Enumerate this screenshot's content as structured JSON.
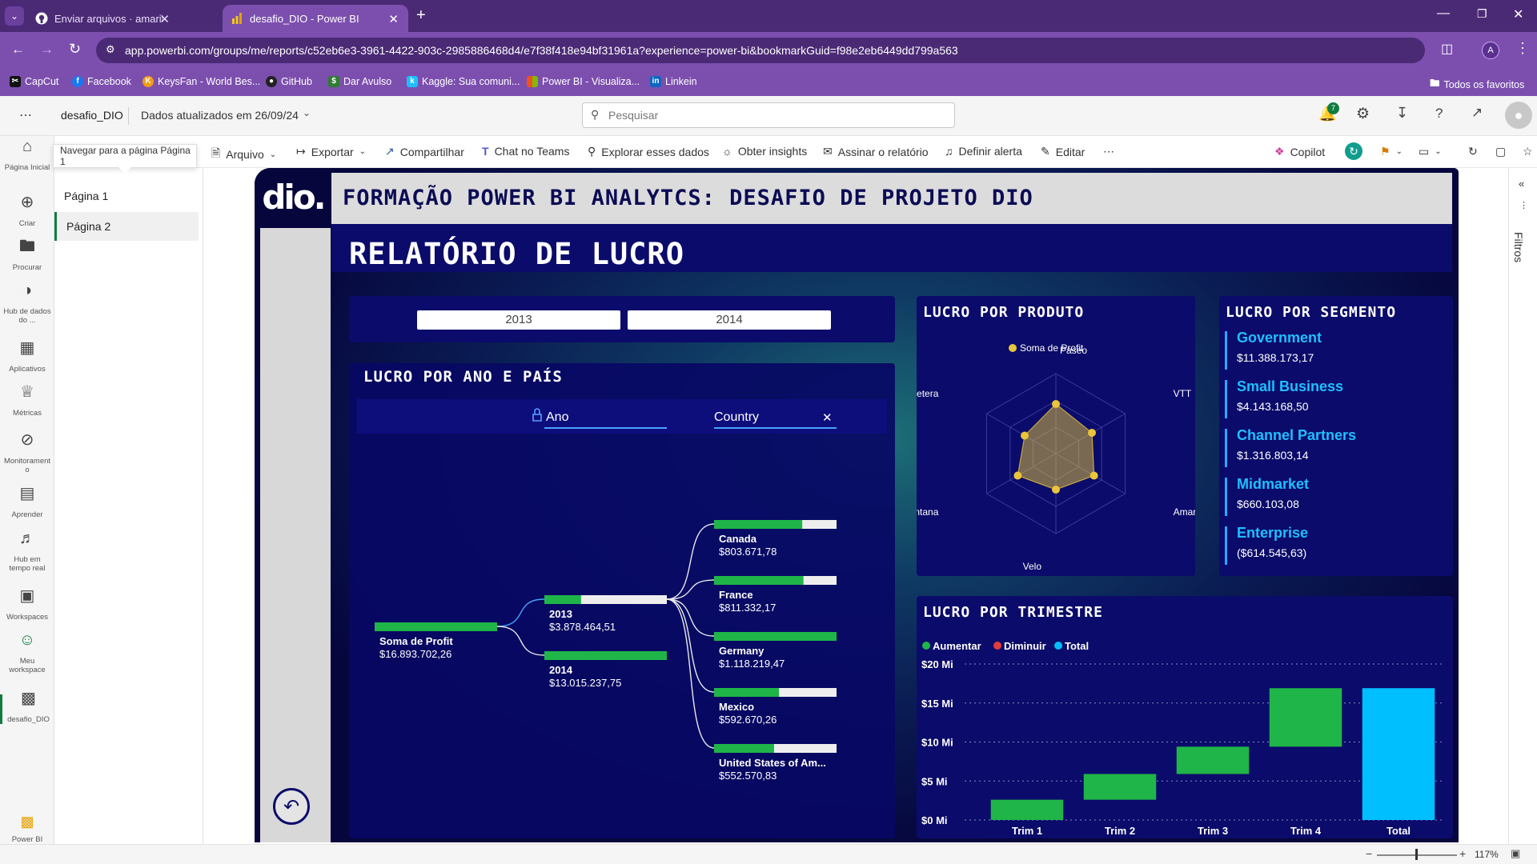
{
  "browser": {
    "tabs": [
      {
        "title": "Enviar arquivos · amarildochag",
        "active": false
      },
      {
        "title": "desafio_DIO - Power BI",
        "active": true
      }
    ],
    "url": "app.powerbi.com/groups/me/reports/c52eb6e3-3961-4422-903c-2985886468d4/e7f38f418e94bf31961a?experience=power-bi&bookmarkGuid=f98e2eb6449dd799a563",
    "bookmarks": [
      "CapCut",
      "Facebook",
      "KeysFan - World Bes...",
      "GitHub",
      "Dar Avulso",
      "Kaggle: Sua comuni...",
      "Power BI - Visualiza...",
      "Linkein"
    ],
    "all_bookmarks": "Todos os favoritos",
    "profile_initial": "A"
  },
  "pbi": {
    "workspace": "desafio_DIO",
    "updated": "Dados atualizados em 26/09/24",
    "search_placeholder": "Pesquisar",
    "notif_count": "7",
    "nav": [
      {
        "label": "Página Inicial",
        "icon": "home-icon"
      },
      {
        "label": "Criar",
        "icon": "create-icon"
      },
      {
        "label": "Procurar",
        "icon": "browse-icon"
      },
      {
        "label": "Hub de dados do ...",
        "icon": "data-hub-icon"
      },
      {
        "label": "Aplicativos",
        "icon": "apps-icon"
      },
      {
        "label": "Métricas",
        "icon": "metrics-icon"
      },
      {
        "label": "Monitoramento",
        "icon": "monitoring-icon"
      },
      {
        "label": "Aprender",
        "icon": "learn-icon"
      },
      {
        "label": "Hub em tempo real",
        "icon": "realtime-hub-icon"
      },
      {
        "label": "Workspaces",
        "icon": "workspaces-icon"
      },
      {
        "label": "Meu workspace",
        "icon": "my-workspace-icon"
      },
      {
        "label": "desafio_DIO",
        "icon": "report-icon"
      }
    ],
    "power_bi_label": "Power BI",
    "toolbar": {
      "arquivo": "Arquivo",
      "exportar": "Exportar",
      "compartilhar": "Compartilhar",
      "chat_teams": "Chat no Teams",
      "explorar": "Explorar esses dados",
      "insights": "Obter insights",
      "assinar": "Assinar o relatório",
      "alerta": "Definir alerta",
      "editar": "Editar",
      "copilot": "Copilot"
    },
    "tooltip": "Navegar para a página Página 1",
    "pages": [
      "Página 1",
      "Página 2"
    ],
    "active_page": 1,
    "filters_label": "Filtros",
    "zoom": "117%"
  },
  "report": {
    "logo": "dio.",
    "header": "FORMAÇÃO POWER BI ANALYTCS: DESAFIO DE PROJETO DIO",
    "title": "RELATÓRIO DE LUCRO",
    "year_slicer": [
      "2013",
      "2014"
    ],
    "colors": {
      "green": "#1fb548",
      "red": "#e03c3c",
      "cyan": "#00bfff",
      "gold": "#e8c53a",
      "panel": "#0b0b6b"
    },
    "tree": {
      "title": "LUCRO POR ANO E PAÍS",
      "col_ano": "Ano",
      "col_country": "Country",
      "root": {
        "label": "Soma de Profit",
        "value": "$16.893.702,26",
        "fill": 1.0
      },
      "years": [
        {
          "label": "2013",
          "value": "$3.878.464,51",
          "fill": 0.3
        },
        {
          "label": "2014",
          "value": "$13.015.237,75",
          "fill": 1.0
        }
      ],
      "countries": [
        {
          "label": "Canada",
          "value": "$803.671,78",
          "fill": 0.72
        },
        {
          "label": "France",
          "value": "$811.332,17",
          "fill": 0.73
        },
        {
          "label": "Germany",
          "value": "$1.118.219,47",
          "fill": 1.0
        },
        {
          "label": "Mexico",
          "value": "$592.670,26",
          "fill": 0.53
        },
        {
          "label": "United States of Am...",
          "value": "$552.570,83",
          "fill": 0.49
        }
      ]
    },
    "radar": {
      "title": "LUCRO POR PRODUTO",
      "legend": "Soma de Profit",
      "axes": [
        "Paseo",
        "VTT",
        "Amarilla",
        "Velo",
        "Montana",
        "Carretera"
      ],
      "values": [
        0.62,
        0.52,
        0.55,
        0.45,
        0.55,
        0.45
      ]
    },
    "segments": {
      "title": "LUCRO POR SEGMENTO",
      "items": [
        {
          "name": "Government",
          "value": "$11.388.173,17"
        },
        {
          "name": "Small Business",
          "value": "$4.143.168,50"
        },
        {
          "name": "Channel Partners",
          "value": "$1.316.803,14"
        },
        {
          "name": "Midmarket",
          "value": "$660.103,08"
        },
        {
          "name": "Enterprise",
          "value": "($614.545,63)"
        }
      ]
    }
  },
  "chart_data": {
    "type": "bar",
    "subtype": "waterfall",
    "title": "LUCRO POR TRIMESTRE",
    "legend": [
      "Aumentar",
      "Diminuir",
      "Total"
    ],
    "categories": [
      "Trim 1",
      "Trim 2",
      "Trim 3",
      "Trim 4",
      "Total"
    ],
    "values": [
      2.6,
      3.3,
      3.5,
      7.5,
      16.9
    ],
    "unit": "Mi",
    "yticks": [
      "$0 Mi",
      "$5 Mi",
      "$10 Mi",
      "$15 Mi",
      "$20 Mi"
    ],
    "ylim": [
      0,
      20
    ],
    "grid": true,
    "legend_position": "top-left"
  }
}
